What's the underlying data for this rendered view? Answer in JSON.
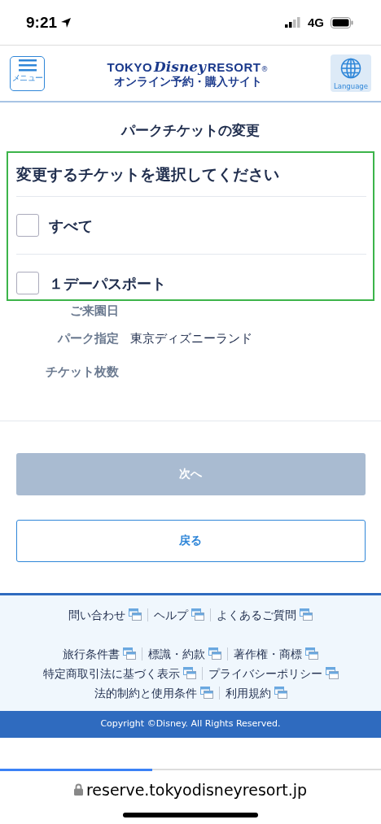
{
  "status_bar": {
    "time": "9:21",
    "network": "4G"
  },
  "header": {
    "menu_label": "メニュー",
    "logo": {
      "left": "TOKYO",
      "script": "Disney",
      "right": "RESORT",
      "mark": "®",
      "subtitle": "オンライン予約・購入サイト"
    },
    "language_label": "Language"
  },
  "page_title": "パークチケットの変更",
  "selection": {
    "heading": "変更するチケットを選択してください",
    "options": [
      {
        "label": "すべて",
        "checked": false
      },
      {
        "label": "１デーパスポート",
        "checked": false
      }
    ]
  },
  "details": [
    {
      "label": "ご来園日"
    },
    {
      "label": "パーク指定",
      "value": "東京ディズニーランド"
    },
    {
      "label": "チケット枚数"
    }
  ],
  "buttons": [
    {
      "label": "次へ",
      "kind": "primary",
      "disabled": true
    },
    {
      "label": "戻る",
      "kind": "outline",
      "disabled": false
    }
  ],
  "footer": {
    "link_rows": [
      [
        "問い合わせ",
        "ヘルプ",
        "よくあるご質問"
      ],
      [
        "旅行条件書",
        "標識・約款",
        "著作権・商標"
      ],
      [
        "特定商取引法に基づく表示",
        "プライバシーポリシー"
      ],
      [
        "法的制約と使用条件",
        "利用規約"
      ]
    ],
    "copyright": "Copyright ©Disney. All Rights Reserved."
  },
  "browser": {
    "url": "reserve.tokyodisneyresort.jp",
    "loading": {
      "level": 0.4
    }
  }
}
